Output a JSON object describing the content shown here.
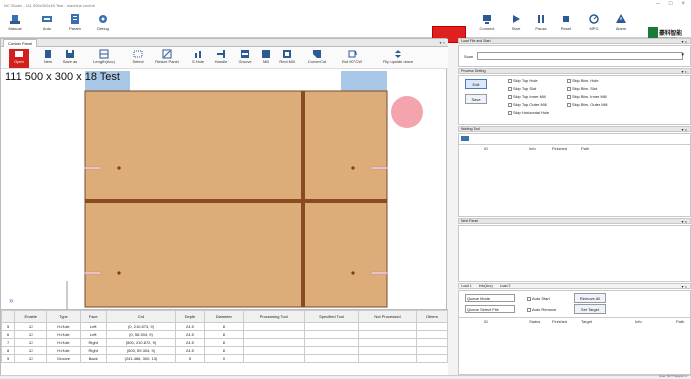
{
  "window": {
    "title": "NC Studio - 111 500x300x18 Test - machine control"
  },
  "toolbar_left": [
    {
      "label": "Manual",
      "icon": "hand-icon"
    },
    {
      "label": "Auto",
      "icon": "auto-icon"
    },
    {
      "label": "Param",
      "icon": "param-icon"
    },
    {
      "label": "Debug",
      "icon": "debug-icon"
    }
  ],
  "toolbar_right": [
    {
      "label": "Connect",
      "icon": "connect-icon"
    },
    {
      "label": "Start",
      "icon": "start-icon"
    },
    {
      "label": "Pause",
      "icon": "pause-icon"
    },
    {
      "label": "Reset",
      "icon": "reset-icon"
    },
    {
      "label": "MPG",
      "icon": "mpg-icon"
    },
    {
      "label": "Alarm",
      "icon": "alarm-icon"
    }
  ],
  "brand": {
    "name": "豪科智能",
    "sub": "HAOKE CNC"
  },
  "tabs": {
    "active": "Curtain Panel"
  },
  "ribbon": [
    {
      "label": "Open",
      "icon": "open-icon",
      "active": true
    },
    {
      "label": "New",
      "icon": "new-icon"
    },
    {
      "label": "Save as",
      "icon": "save-as-icon"
    },
    {
      "label": "Length(Acc)",
      "icon": "length-icon"
    },
    {
      "label": "Select",
      "icon": "select-icon"
    },
    {
      "label": "Resize Panel",
      "icon": "resize-icon"
    },
    {
      "label": "S.Hole",
      "icon": "hole-icon"
    },
    {
      "label": "Handle",
      "icon": "handle-icon"
    },
    {
      "label": "Groove",
      "icon": "groove-icon"
    },
    {
      "label": "Mill",
      "icon": "mill-icon"
    },
    {
      "label": "Rect.Mill",
      "icon": "rect-mill-icon"
    },
    {
      "label": "CornerCut",
      "icon": "corner-icon"
    },
    {
      "label": "Rot 90°CW",
      "icon": "rotate-icon"
    },
    {
      "label": "Flip upside down",
      "icon": "flip-icon"
    }
  ],
  "panel": {
    "label": "111  500 x 300 x 18 Test"
  },
  "table": {
    "headers": [
      "",
      "Enable",
      "Type",
      "Face",
      "Crd",
      "Depth",
      "Diameter",
      "Processing Tool",
      "Specified Tool",
      "Not Processed",
      "Others"
    ],
    "rows": [
      [
        "5",
        "☑",
        "H-Hole",
        "Left",
        "(0, 210.873, 9)",
        "24.5",
        "8",
        "",
        "",
        "",
        ""
      ],
      [
        "6",
        "☑",
        "H-Hole",
        "Left",
        "(0, 56.304, 9)",
        "24.5",
        "8",
        "",
        "",
        "",
        ""
      ],
      [
        "7",
        "☑",
        "H-Hole",
        "Right",
        "(500, 210.872, 9)",
        "24.5",
        "8",
        "",
        "",
        "",
        ""
      ],
      [
        "8",
        "☑",
        "H-Hole",
        "Right",
        "(500, 59.304, 9)",
        "24.5",
        "8",
        "",
        "",
        "",
        ""
      ],
      [
        "9",
        "☑",
        "Groove",
        "Back",
        "(241.466, 300, 13)",
        "5",
        "0",
        "",
        "",
        "",
        ""
      ]
    ]
  },
  "right": {
    "load_header": "Load File and Start",
    "scan_label": "Scan",
    "process_header": "Process Setting",
    "edit_button": "Edit",
    "save_button": "Save",
    "checks": [
      "Skip Top Hole",
      "Skip Btm. Hole",
      "Skip Top Slot",
      "Skip Btm. Slot",
      "Skip Top Inner Mill",
      "Skip Btm. Inner Mill",
      "Skip Top Outer Mill",
      "Skip Btm. Outer Mill",
      "Skip Horizontal Hole"
    ],
    "waiting_header": "Waiting Tool",
    "waiting_cols": [
      "ID",
      "Info",
      "Finished",
      "Path"
    ],
    "next_header": "Next Panel",
    "bottom_tabs": [
      "Load 1",
      "Info(Acc)",
      "Load 2"
    ],
    "queue_mode": "Queue Mode",
    "queue_select": "Queue Select File",
    "auto_start": "Auto Start",
    "auto_remove": "Auto Remove",
    "remove_all": "Remove All",
    "set_target": "Set Target",
    "queue_cols": [
      "ID",
      "Status",
      "Finished",
      "Target",
      "Info",
      "Path"
    ]
  },
  "status": {
    "text": "User: NCT Support 1"
  }
}
